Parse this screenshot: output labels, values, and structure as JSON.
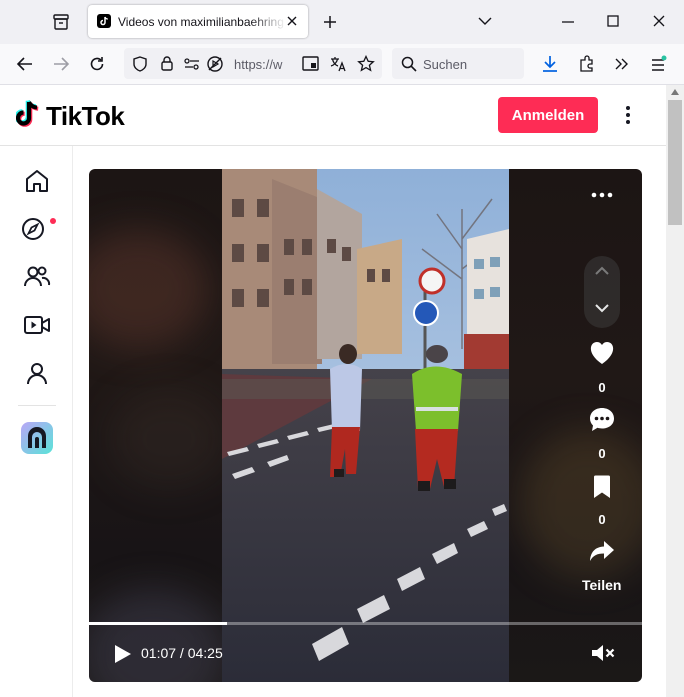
{
  "browser": {
    "tab_title": "Videos von maximilianbaehring",
    "url": "https://w",
    "search_placeholder": "Suchen"
  },
  "tiktok": {
    "logo_text": "TikTok",
    "login_label": "Anmelden"
  },
  "video": {
    "likes": "0",
    "comments": "0",
    "bookmarks": "0",
    "share_label": "Teilen",
    "time_display": "01:07 / 04:25",
    "progress": 0.25
  },
  "colors": {
    "brand": "#fe2c55",
    "notification_dot": "#fe2c55"
  }
}
